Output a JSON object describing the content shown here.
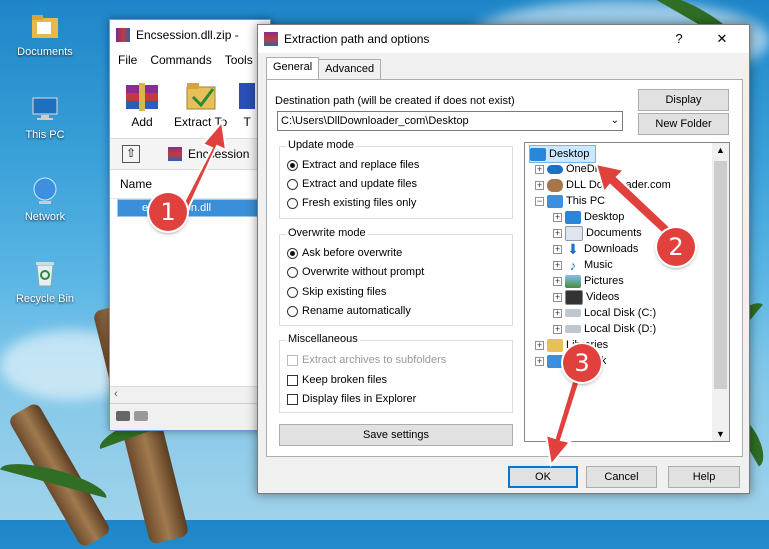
{
  "desktop": {
    "icons": [
      {
        "label": "Documents",
        "icon": "folder-icon"
      },
      {
        "label": "This PC",
        "icon": "computer-icon"
      },
      {
        "label": "Network",
        "icon": "network-icon"
      },
      {
        "label": "Recycle Bin",
        "icon": "recycle-bin-icon"
      }
    ]
  },
  "winrar": {
    "title": "Encsession.dll.zip -",
    "menu": [
      "File",
      "Commands",
      "Tools"
    ],
    "tools": [
      {
        "label": "Add",
        "icon": "add-archive-icon"
      },
      {
        "label": "Extract To",
        "icon": "extract-to-icon"
      },
      {
        "label": "T",
        "icon": "test-icon"
      }
    ],
    "address": "Encsession",
    "column_name": "Name",
    "file": "encsession.dll"
  },
  "dialog": {
    "title": "Extraction path and options",
    "help_glyph": "?",
    "close_glyph": "✕",
    "tabs": [
      "General",
      "Advanced"
    ],
    "dest_label": "Destination path (will be created if does not exist)",
    "dest_value": "C:\\Users\\DllDownloader_com\\Desktop",
    "display_button": "Display",
    "new_folder_button": "New Folder",
    "update_mode": {
      "title": "Update mode",
      "options": [
        "Extract and replace files",
        "Extract and update files",
        "Fresh existing files only"
      ]
    },
    "overwrite_mode": {
      "title": "Overwrite mode",
      "options": [
        "Ask before overwrite",
        "Overwrite without prompt",
        "Skip existing files",
        "Rename automatically"
      ]
    },
    "misc": {
      "title": "Miscellaneous",
      "options": [
        "Extract archives to subfolders",
        "Keep broken files",
        "Display files in Explorer"
      ]
    },
    "save_settings": "Save settings",
    "tree": [
      {
        "label": "Desktop",
        "icon": "desktop-icon",
        "selected": true
      },
      {
        "label": "OneDrive",
        "icon": "onedrive-icon"
      },
      {
        "label": "DLL Downloader.com",
        "icon": "user-icon"
      },
      {
        "label": "This PC",
        "icon": "computer-icon"
      },
      {
        "label": "Desktop",
        "icon": "desktop-icon"
      },
      {
        "label": "Documents",
        "icon": "documents-icon"
      },
      {
        "label": "Downloads",
        "icon": "downloads-icon"
      },
      {
        "label": "Music",
        "icon": "music-icon"
      },
      {
        "label": "Pictures",
        "icon": "pictures-icon"
      },
      {
        "label": "Videos",
        "icon": "videos-icon"
      },
      {
        "label": "Local Disk (C:)",
        "icon": "drive-icon"
      },
      {
        "label": "Local Disk (D:)",
        "icon": "drive-icon"
      },
      {
        "label": "Libraries",
        "icon": "libraries-icon"
      },
      {
        "label": "Network",
        "icon": "network-icon"
      }
    ],
    "ok": "OK",
    "cancel": "Cancel",
    "help": "Help"
  },
  "annotations": [
    "1",
    "2",
    "3"
  ],
  "colors": {
    "annotation": "#e0413c",
    "selection": "#0078d7"
  }
}
